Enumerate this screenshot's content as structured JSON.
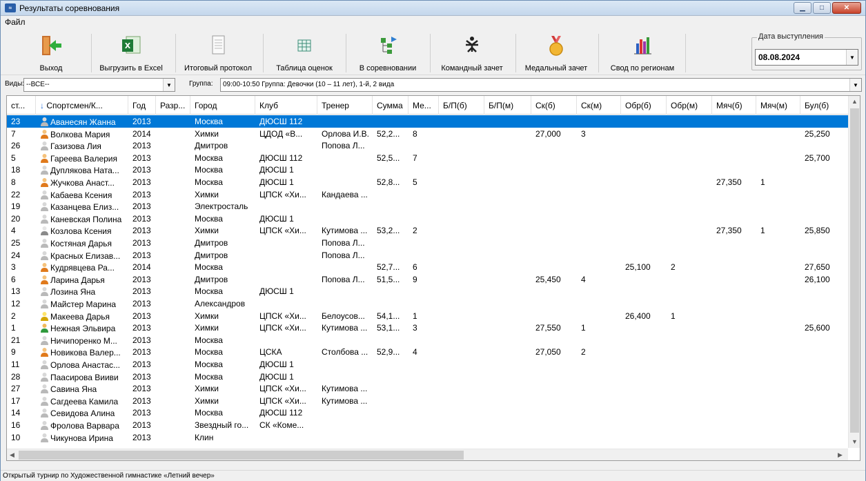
{
  "window": {
    "title": "Результаты соревнования"
  },
  "menu": {
    "file": "Файл"
  },
  "toolbar": {
    "exit": "Выход",
    "excel": "Выгрузить в Excel",
    "protocol": "Итоговый протокол",
    "scores": "Таблица оценок",
    "in_competition": "В соревновании",
    "team": "Командный зачет",
    "medal": "Медальный зачет",
    "regions": "Свод по регионам",
    "date_label": "Дата выступления",
    "date_value": "08.08.2024"
  },
  "filters": {
    "types_label": "Виды:",
    "types_value": "--ВСЕ--",
    "group_label": "Группа:",
    "group_value": "09:00-10:50 Группа: Девочки (10 – 11 лет), 1-й, 2 вида"
  },
  "columns": [
    "ст...",
    "Спортсмен/К...",
    "Год",
    "Разр...",
    "Город",
    "Клуб",
    "Тренер",
    "Сумма",
    "Ме...",
    "Б/П(б)",
    "Б/П(м)",
    "Ск(б)",
    "Ск(м)",
    "Обр(б)",
    "Обр(м)",
    "Мяч(б)",
    "Мяч(м)",
    "Бул(б)"
  ],
  "rows": [
    {
      "num": "23",
      "name": "Аванесян Жанна",
      "year": "2013",
      "rank": "",
      "city": "Москва",
      "club": "ДЮСШ 112",
      "coach": "",
      "sum": "",
      "place": "",
      "bp_b": "",
      "bp_m": "",
      "sk_b": "",
      "sk_m": "",
      "obr_b": "",
      "obr_m": "",
      "ball_b": "",
      "ball_m": "",
      "bul_b": "",
      "icon": "gray",
      "selected": true
    },
    {
      "num": "7",
      "name": "Волкова Мария",
      "year": "2014",
      "rank": "",
      "city": "Химки",
      "club": "ЦДОД «В...",
      "coach": "Орлова И.В.",
      "sum": "52,2...",
      "place": "8",
      "bp_b": "",
      "bp_m": "",
      "sk_b": "27,000",
      "sk_m": "3",
      "obr_b": "",
      "obr_m": "",
      "ball_b": "",
      "ball_m": "",
      "bul_b": "25,250",
      "icon": "orange"
    },
    {
      "num": "26",
      "name": "Газизова Лия",
      "year": "2013",
      "rank": "",
      "city": "Дмитров",
      "club": "",
      "coach": "Попова Л...",
      "sum": "",
      "place": "",
      "bp_b": "",
      "bp_m": "",
      "sk_b": "",
      "sk_m": "",
      "obr_b": "",
      "obr_m": "",
      "ball_b": "",
      "ball_m": "",
      "bul_b": "",
      "icon": "gray"
    },
    {
      "num": "5",
      "name": "Гареева Валерия",
      "year": "2013",
      "rank": "",
      "city": "Москва",
      "club": "ДЮСШ 112",
      "coach": "",
      "sum": "52,5...",
      "place": "7",
      "bp_b": "",
      "bp_m": "",
      "sk_b": "",
      "sk_m": "",
      "obr_b": "",
      "obr_m": "",
      "ball_b": "",
      "ball_m": "",
      "bul_b": "25,700",
      "icon": "orange"
    },
    {
      "num": "18",
      "name": "Дуплякова Ната...",
      "year": "2013",
      "rank": "",
      "city": "Москва",
      "club": "ДЮСШ 1",
      "coach": "",
      "sum": "",
      "place": "",
      "bp_b": "",
      "bp_m": "",
      "sk_b": "",
      "sk_m": "",
      "obr_b": "",
      "obr_m": "",
      "ball_b": "",
      "ball_m": "",
      "bul_b": "",
      "icon": "gray"
    },
    {
      "num": "8",
      "name": "Жучкова Анаст...",
      "year": "2013",
      "rank": "",
      "city": "Москва",
      "club": "ДЮСШ 1",
      "coach": "",
      "sum": "52,8...",
      "place": "5",
      "bp_b": "",
      "bp_m": "",
      "sk_b": "",
      "sk_m": "",
      "obr_b": "",
      "obr_m": "",
      "ball_b": "27,350",
      "ball_m": "1",
      "bul_b": "",
      "icon": "orange"
    },
    {
      "num": "22",
      "name": "Кабаева Ксения",
      "year": "2013",
      "rank": "",
      "city": "Химки",
      "club": "ЦПСК «Хи...",
      "coach": "Кандаева ...",
      "sum": "",
      "place": "",
      "bp_b": "",
      "bp_m": "",
      "sk_b": "",
      "sk_m": "",
      "obr_b": "",
      "obr_m": "",
      "ball_b": "",
      "ball_m": "",
      "bul_b": "",
      "icon": "gray"
    },
    {
      "num": "19",
      "name": "Казанцева Елиз...",
      "year": "2013",
      "rank": "",
      "city": "Электросталь",
      "club": "",
      "coach": "",
      "sum": "",
      "place": "",
      "bp_b": "",
      "bp_m": "",
      "sk_b": "",
      "sk_m": "",
      "obr_b": "",
      "obr_m": "",
      "ball_b": "",
      "ball_m": "",
      "bul_b": "",
      "icon": "gray"
    },
    {
      "num": "20",
      "name": "Каневская Полина",
      "year": "2013",
      "rank": "",
      "city": "Москва",
      "club": "ДЮСШ 1",
      "coach": "",
      "sum": "",
      "place": "",
      "bp_b": "",
      "bp_m": "",
      "sk_b": "",
      "sk_m": "",
      "obr_b": "",
      "obr_m": "",
      "ball_b": "",
      "ball_m": "",
      "bul_b": "",
      "icon": "gray"
    },
    {
      "num": "4",
      "name": "Козлова Ксения",
      "year": "2013",
      "rank": "",
      "city": "Химки",
      "club": "ЦПСК «Хи...",
      "coach": "Кутимова ...",
      "sum": "53,2...",
      "place": "2",
      "bp_b": "",
      "bp_m": "",
      "sk_b": "",
      "sk_m": "",
      "obr_b": "",
      "obr_m": "",
      "ball_b": "27,350",
      "ball_m": "1",
      "bul_b": "25,850",
      "icon": "silver"
    },
    {
      "num": "25",
      "name": "Костяная Дарья",
      "year": "2013",
      "rank": "",
      "city": "Дмитров",
      "club": "",
      "coach": "Попова Л...",
      "sum": "",
      "place": "",
      "bp_b": "",
      "bp_m": "",
      "sk_b": "",
      "sk_m": "",
      "obr_b": "",
      "obr_m": "",
      "ball_b": "",
      "ball_m": "",
      "bul_b": "",
      "icon": "gray"
    },
    {
      "num": "24",
      "name": "Красных Елизав...",
      "year": "2013",
      "rank": "",
      "city": "Дмитров",
      "club": "",
      "coach": "Попова Л...",
      "sum": "",
      "place": "",
      "bp_b": "",
      "bp_m": "",
      "sk_b": "",
      "sk_m": "",
      "obr_b": "",
      "obr_m": "",
      "ball_b": "",
      "ball_m": "",
      "bul_b": "",
      "icon": "gray"
    },
    {
      "num": "3",
      "name": "Кудрявцева Ра...",
      "year": "2014",
      "rank": "",
      "city": "Москва",
      "club": "",
      "coach": "",
      "sum": "52,7...",
      "place": "6",
      "bp_b": "",
      "bp_m": "",
      "sk_b": "",
      "sk_m": "",
      "obr_b": "25,100",
      "obr_m": "2",
      "ball_b": "",
      "ball_m": "",
      "bul_b": "27,650",
      "icon": "orange"
    },
    {
      "num": "6",
      "name": "Ларина Дарья",
      "year": "2013",
      "rank": "",
      "city": "Дмитров",
      "club": "",
      "coach": "Попова Л...",
      "sum": "51,5...",
      "place": "9",
      "bp_b": "",
      "bp_m": "",
      "sk_b": "25,450",
      "sk_m": "4",
      "obr_b": "",
      "obr_m": "",
      "ball_b": "",
      "ball_m": "",
      "bul_b": "26,100",
      "icon": "orange"
    },
    {
      "num": "13",
      "name": "Лозина Яна",
      "year": "2013",
      "rank": "",
      "city": "Москва",
      "club": "ДЮСШ 1",
      "coach": "",
      "sum": "",
      "place": "",
      "bp_b": "",
      "bp_m": "",
      "sk_b": "",
      "sk_m": "",
      "obr_b": "",
      "obr_m": "",
      "ball_b": "",
      "ball_m": "",
      "bul_b": "",
      "icon": "gray"
    },
    {
      "num": "12",
      "name": "Майстер Марина",
      "year": "2013",
      "rank": "",
      "city": "Александров",
      "club": "",
      "coach": "",
      "sum": "",
      "place": "",
      "bp_b": "",
      "bp_m": "",
      "sk_b": "",
      "sk_m": "",
      "obr_b": "",
      "obr_m": "",
      "ball_b": "",
      "ball_m": "",
      "bul_b": "",
      "icon": "gray"
    },
    {
      "num": "2",
      "name": "Макеева Дарья",
      "year": "2013",
      "rank": "",
      "city": "Химки",
      "club": "ЦПСК «Хи...",
      "coach": "Белоусов...",
      "sum": "54,1...",
      "place": "1",
      "bp_b": "",
      "bp_m": "",
      "sk_b": "",
      "sk_m": "",
      "obr_b": "26,400",
      "obr_m": "1",
      "ball_b": "",
      "ball_m": "",
      "bul_b": "",
      "icon": "gold"
    },
    {
      "num": "1",
      "name": "Нежная Эльвира",
      "year": "2013",
      "rank": "",
      "city": "Химки",
      "club": "ЦПСК «Хи...",
      "coach": "Кутимова ...",
      "sum": "53,1...",
      "place": "3",
      "bp_b": "",
      "bp_m": "",
      "sk_b": "27,550",
      "sk_m": "1",
      "obr_b": "",
      "obr_m": "",
      "ball_b": "",
      "ball_m": "",
      "bul_b": "25,600",
      "icon": "bronze"
    },
    {
      "num": "21",
      "name": "Ничипоренко М...",
      "year": "2013",
      "rank": "",
      "city": "Москва",
      "club": "",
      "coach": "",
      "sum": "",
      "place": "",
      "bp_b": "",
      "bp_m": "",
      "sk_b": "",
      "sk_m": "",
      "obr_b": "",
      "obr_m": "",
      "ball_b": "",
      "ball_m": "",
      "bul_b": "",
      "icon": "gray"
    },
    {
      "num": "9",
      "name": "Новикова Валер...",
      "year": "2013",
      "rank": "",
      "city": "Москва",
      "club": "ЦСКА",
      "coach": "Столбова ...",
      "sum": "52,9...",
      "place": "4",
      "bp_b": "",
      "bp_m": "",
      "sk_b": "27,050",
      "sk_m": "2",
      "obr_b": "",
      "obr_m": "",
      "ball_b": "",
      "ball_m": "",
      "bul_b": "",
      "icon": "orange"
    },
    {
      "num": "11",
      "name": "Орлова Анастас...",
      "year": "2013",
      "rank": "",
      "city": "Москва",
      "club": "ДЮСШ 1",
      "coach": "",
      "sum": "",
      "place": "",
      "bp_b": "",
      "bp_m": "",
      "sk_b": "",
      "sk_m": "",
      "obr_b": "",
      "obr_m": "",
      "ball_b": "",
      "ball_m": "",
      "bul_b": "",
      "icon": "gray"
    },
    {
      "num": "28",
      "name": "Паасирова Вииви",
      "year": "2013",
      "rank": "",
      "city": "Москва",
      "club": "ДЮСШ 1",
      "coach": "",
      "sum": "",
      "place": "",
      "bp_b": "",
      "bp_m": "",
      "sk_b": "",
      "sk_m": "",
      "obr_b": "",
      "obr_m": "",
      "ball_b": "",
      "ball_m": "",
      "bul_b": "",
      "icon": "gray"
    },
    {
      "num": "27",
      "name": "Савина Яна",
      "year": "2013",
      "rank": "",
      "city": "Химки",
      "club": "ЦПСК «Хи...",
      "coach": "Кутимова ...",
      "sum": "",
      "place": "",
      "bp_b": "",
      "bp_m": "",
      "sk_b": "",
      "sk_m": "",
      "obr_b": "",
      "obr_m": "",
      "ball_b": "",
      "ball_m": "",
      "bul_b": "",
      "icon": "gray"
    },
    {
      "num": "17",
      "name": "Сагдеева Камила",
      "year": "2013",
      "rank": "",
      "city": "Химки",
      "club": "ЦПСК «Хи...",
      "coach": "Кутимова ...",
      "sum": "",
      "place": "",
      "bp_b": "",
      "bp_m": "",
      "sk_b": "",
      "sk_m": "",
      "obr_b": "",
      "obr_m": "",
      "ball_b": "",
      "ball_m": "",
      "bul_b": "",
      "icon": "gray"
    },
    {
      "num": "14",
      "name": "Севидова Алина",
      "year": "2013",
      "rank": "",
      "city": "Москва",
      "club": "ДЮСШ 112",
      "coach": "",
      "sum": "",
      "place": "",
      "bp_b": "",
      "bp_m": "",
      "sk_b": "",
      "sk_m": "",
      "obr_b": "",
      "obr_m": "",
      "ball_b": "",
      "ball_m": "",
      "bul_b": "",
      "icon": "gray"
    },
    {
      "num": "16",
      "name": "Фролова Варвара",
      "year": "2013",
      "rank": "",
      "city": "Звездный го...",
      "club": "СК «Коме...",
      "coach": "",
      "sum": "",
      "place": "",
      "bp_b": "",
      "bp_m": "",
      "sk_b": "",
      "sk_m": "",
      "obr_b": "",
      "obr_m": "",
      "ball_b": "",
      "ball_m": "",
      "bul_b": "",
      "icon": "gray"
    },
    {
      "num": "10",
      "name": "Чикунова Ирина",
      "year": "2013",
      "rank": "",
      "city": "Клин",
      "club": "",
      "coach": "",
      "sum": "",
      "place": "",
      "bp_b": "",
      "bp_m": "",
      "sk_b": "",
      "sk_m": "",
      "obr_b": "",
      "obr_m": "",
      "ball_b": "",
      "ball_m": "",
      "bul_b": "",
      "icon": "gray"
    }
  ],
  "status": {
    "text": "Открытый турнир по Художественной гимнастике «Летний вечер»"
  },
  "colors": {
    "selection": "#0078d7",
    "accent_title": "#c4d7ec"
  }
}
